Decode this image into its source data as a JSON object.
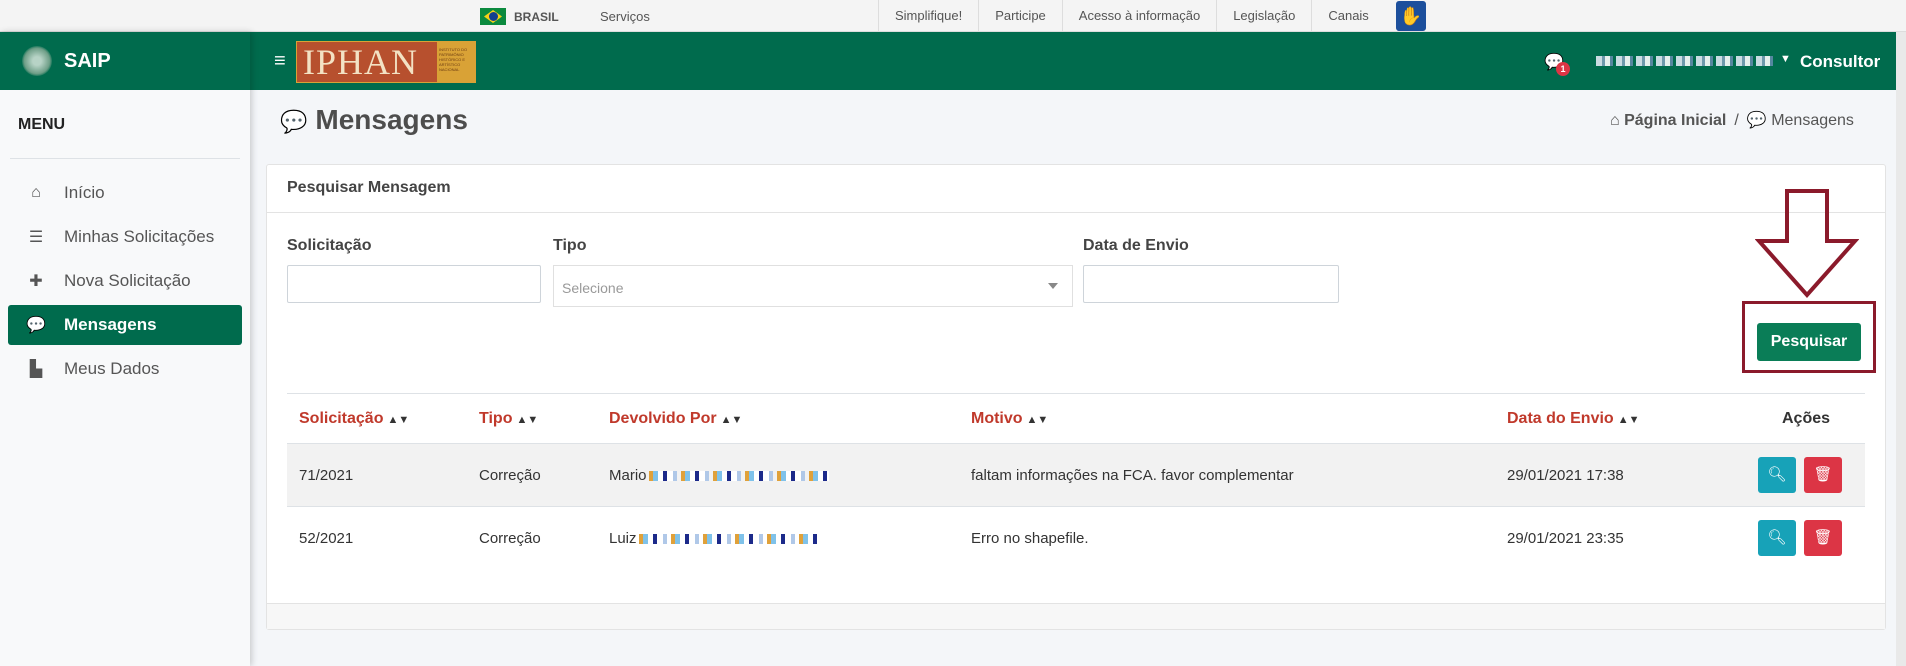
{
  "gov_bar": {
    "country": "BRASIL",
    "services": "Serviços",
    "links": [
      "Simplifique!",
      "Participe",
      "Acesso à informação",
      "Legislação",
      "Canais"
    ]
  },
  "sidebar": {
    "app_name": "SAIP",
    "menu_title": "MENU",
    "items": [
      {
        "label": "Início",
        "icon": "home-icon",
        "active": false
      },
      {
        "label": "Minhas Solicitações",
        "icon": "list-icon",
        "active": false
      },
      {
        "label": "Nova Solicitação",
        "icon": "plus-icon",
        "active": false
      },
      {
        "label": "Mensagens",
        "icon": "comments-icon",
        "active": true
      },
      {
        "label": "Meus Dados",
        "icon": "file-icon",
        "active": false
      }
    ]
  },
  "header": {
    "logo_text": "IPHAN",
    "logo_subtext": "INSTITUTO DO PATRIMÔNIO HISTÓRICO E ARTÍSTICO NACIONAL",
    "notification_count": "1",
    "role": "Consultor"
  },
  "page": {
    "title": "Mensagens",
    "breadcrumb_home": "Página Inicial",
    "breadcrumb_current": "Mensagens"
  },
  "search": {
    "card_title": "Pesquisar Mensagem",
    "solicitacao_label": "Solicitação",
    "tipo_label": "Tipo",
    "tipo_placeholder": "Selecione",
    "data_label": "Data de Envio",
    "button_label": "Pesquisar"
  },
  "table": {
    "headers": [
      "Solicitação",
      "Tipo",
      "Devolvido Por",
      "Motivo",
      "Data do Envio",
      "Ações"
    ],
    "rows": [
      {
        "solicitacao": "71/2021",
        "tipo": "Correção",
        "devolvido_por": "Mario",
        "motivo": "faltam informações na FCA. favor complementar",
        "data": "29/01/2021 17:38"
      },
      {
        "solicitacao": "52/2021",
        "tipo": "Correção",
        "devolvido_por": "Luiz",
        "motivo": "Erro no shapefile.",
        "data": "29/01/2021 23:35"
      }
    ]
  },
  "colors": {
    "primary": "#006b4d",
    "button": "#0a7d57",
    "sort_header": "#c0392b",
    "view_button": "#17a2b8",
    "delete_button": "#dc3545",
    "annotation": "#8b1a2b"
  }
}
